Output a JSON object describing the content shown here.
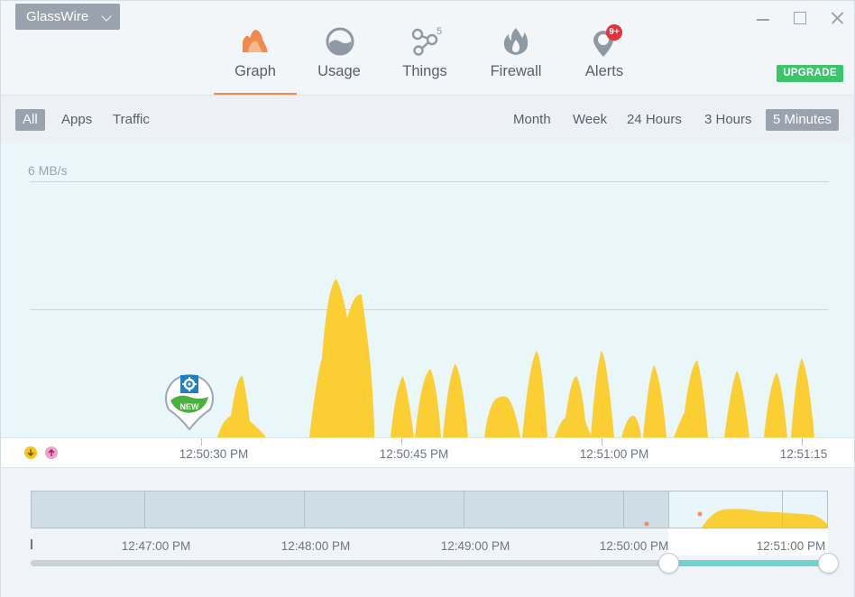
{
  "app": {
    "title": "GlassWire"
  },
  "nav": {
    "tabs": [
      {
        "label": "Graph",
        "icon": "graph-icon",
        "active": true
      },
      {
        "label": "Usage",
        "icon": "usage-icon"
      },
      {
        "label": "Things",
        "icon": "things-icon",
        "count": "5"
      },
      {
        "label": "Firewall",
        "icon": "firewall-icon"
      },
      {
        "label": "Alerts",
        "icon": "alerts-icon",
        "badge": "9+"
      }
    ],
    "upgrade_label": "UPGRADE"
  },
  "filters": {
    "views": [
      "All",
      "Apps",
      "Traffic"
    ],
    "active_view": "All",
    "ranges": [
      "Month",
      "Week",
      "24 Hours",
      "3 Hours",
      "5 Minutes"
    ],
    "active_range": "5 Minutes"
  },
  "graph": {
    "scale_label": "6 MB/s",
    "new_badge": "NEW",
    "time_labels": [
      "12:50:30 PM",
      "12:50:45 PM",
      "12:51:00 PM",
      "12:51:15"
    ]
  },
  "overview": {
    "time_labels": [
      "12:47:00 PM",
      "12:48:00 PM",
      "12:49:00 PM",
      "12:50:00 PM",
      "12:51:00 PM"
    ]
  },
  "colors": {
    "download": "#f5c518",
    "upload": "#f2a0c8",
    "accent": "#f08b4b",
    "upgrade": "#3cc56a",
    "alert_badge": "#e4323a"
  }
}
